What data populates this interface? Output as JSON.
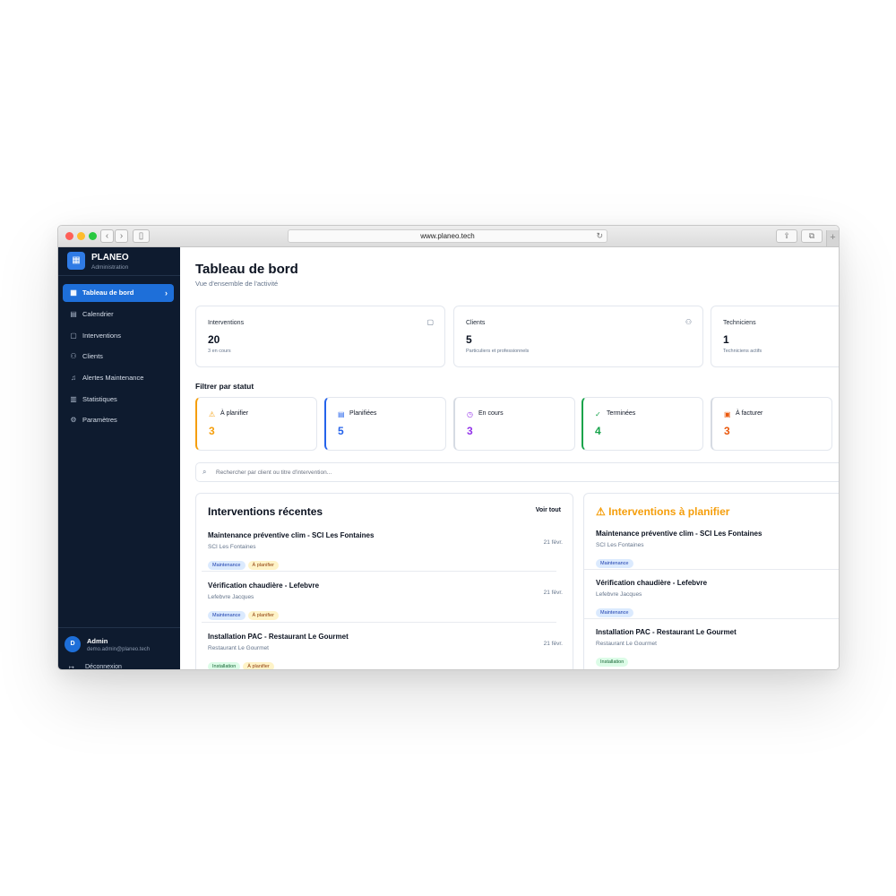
{
  "browser": {
    "url": "www.planeo.tech"
  },
  "sidebar": {
    "brand": {
      "name": "PLANEO",
      "subtitle": "Administration"
    },
    "items": [
      {
        "label": "Tableau de bord",
        "icon": "dashboard-icon",
        "active": true
      },
      {
        "label": "Calendrier",
        "icon": "calendar-icon"
      },
      {
        "label": "Interventions",
        "icon": "clipboard-icon"
      },
      {
        "label": "Clients",
        "icon": "users-icon"
      },
      {
        "label": "Alertes Maintenance",
        "icon": "bell-icon"
      },
      {
        "label": "Statistiques",
        "icon": "bar-chart-icon"
      },
      {
        "label": "Paramètres",
        "icon": "gear-icon"
      }
    ],
    "user": {
      "initial": "D",
      "name": "Admin",
      "email": "demo.admin@planeo.tech"
    },
    "logout_label": "Déconnexion"
  },
  "header": {
    "title": "Tableau de bord",
    "subtitle": "Vue d'ensemble de l'activité"
  },
  "stats": [
    {
      "label": "Interventions",
      "value": "20",
      "note": "3 en cours",
      "icon": "clipboard-icon"
    },
    {
      "label": "Clients",
      "value": "5",
      "note": "Particuliers et professionnels",
      "icon": "users-icon"
    },
    {
      "label": "Techniciens",
      "value": "1",
      "note": "Techniciens actifs"
    }
  ],
  "filters": {
    "title": "Filtrer par statut",
    "items": [
      {
        "label": "À planifier",
        "count": "3",
        "icon": "warning-icon",
        "color": "#f59e0b"
      },
      {
        "label": "Planifiées",
        "count": "5",
        "icon": "calendar-icon",
        "color": "#2563eb"
      },
      {
        "label": "En cours",
        "count": "3",
        "icon": "clock-icon",
        "color": "#9333ea"
      },
      {
        "label": "Terminées",
        "count": "4",
        "icon": "check-circle-icon",
        "color": "#16a34a"
      },
      {
        "label": "À facturer",
        "count": "3",
        "icon": "invoice-icon",
        "color": "#ea580c"
      }
    ]
  },
  "search": {
    "placeholder": "Rechercher par client ou titre d'intervention..."
  },
  "recent": {
    "title": "Interventions récentes",
    "view_all": "Voir tout",
    "rows": [
      {
        "title": "Maintenance préventive clim - SCI Les Fontaines",
        "client": "SCI Les Fontaines",
        "date": "21 févr.",
        "tags": [
          "Maintenance",
          "À planifier"
        ]
      },
      {
        "title": "Vérification chaudière - Lefebvre",
        "client": "Lefebvre Jacques",
        "date": "21 févr.",
        "tags": [
          "Maintenance",
          "À planifier"
        ]
      },
      {
        "title": "Installation PAC - Restaurant Le Gourmet",
        "client": "Restaurant Le Gourmet",
        "date": "21 févr.",
        "tags": [
          "Installation",
          "À planifier"
        ]
      }
    ]
  },
  "to_plan": {
    "title": "Interventions à planifier",
    "rows": [
      {
        "title": "Maintenance préventive clim - SCI Les Fontaines",
        "client": "SCI Les Fontaines",
        "tags": [
          "Maintenance"
        ]
      },
      {
        "title": "Vérification chaudière - Lefebvre",
        "client": "Lefebvre Jacques",
        "tags": [
          "Maintenance"
        ]
      },
      {
        "title": "Installation PAC - Restaurant Le Gourmet",
        "client": "Restaurant Le Gourmet",
        "tags": [
          "Installation"
        ]
      }
    ]
  }
}
